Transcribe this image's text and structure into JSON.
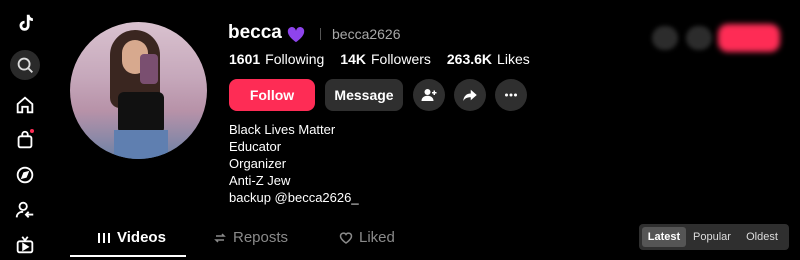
{
  "profile": {
    "display_name": "becca",
    "handle": "becca2626",
    "stats": {
      "following_value": "1601",
      "following_label": "Following",
      "followers_value": "14K",
      "followers_label": "Followers",
      "likes_value": "263.6K",
      "likes_label": "Likes"
    },
    "bio": "Black Lives Matter\nEducator\nOrganizer\nAnti-Z Jew\nbackup @becca2626_"
  },
  "actions": {
    "follow_label": "Follow",
    "message_label": "Message"
  },
  "tabs": [
    {
      "label": "Videos",
      "icon": "bars-icon"
    },
    {
      "label": "Reposts",
      "icon": "repost-icon"
    },
    {
      "label": "Liked",
      "icon": "liked-heart-icon"
    }
  ],
  "sort": {
    "latest": "Latest",
    "popular": "Popular",
    "oldest": "Oldest",
    "selected": "Latest"
  },
  "sidebar_icons": [
    "tiktok-logo-icon",
    "search-icon",
    "home-icon",
    "shop-icon",
    "explore-icon",
    "following-icon",
    "live-icon"
  ],
  "colors": {
    "accent": "#fe2c55",
    "heart": "#8e44ec",
    "background": "#000000"
  }
}
